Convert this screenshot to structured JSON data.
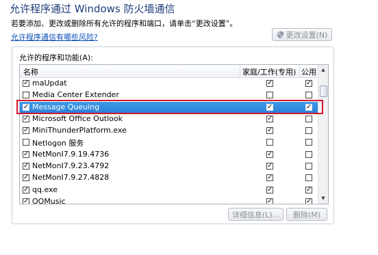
{
  "window": {
    "title": "允许程序通过 Windows 防火墙通信",
    "description": "若要添加、更改或删除所有允许的程序和端口，请单击“更改设置”。",
    "risk_link": "允许程序通信有哪些风险?",
    "change_settings_label": "更改设置(N)"
  },
  "group": {
    "label": "允许的程序和功能(A):",
    "columns": {
      "name": "名称",
      "home": "家庭/工作(专用)",
      "public": "公用"
    }
  },
  "programs": [
    {
      "name": "maUpdat",
      "enabled": true,
      "home": true,
      "public": true
    },
    {
      "name": "Media Center Extender",
      "enabled": false,
      "home": false,
      "public": false
    },
    {
      "name": "Message Queuing",
      "enabled": true,
      "home": true,
      "public": true
    },
    {
      "name": "Microsoft Office Outlook",
      "enabled": true,
      "home": true,
      "public": false
    },
    {
      "name": "MiniThunderPlatform.exe",
      "enabled": true,
      "home": true,
      "public": false
    },
    {
      "name": "Netlogon 服务",
      "enabled": false,
      "home": false,
      "public": false
    },
    {
      "name": "NetMonI7.9.19.4736",
      "enabled": true,
      "home": true,
      "public": false
    },
    {
      "name": "NetMonI7.9.23.4792",
      "enabled": true,
      "home": true,
      "public": false
    },
    {
      "name": "NetMonI7.9.27.4828",
      "enabled": true,
      "home": true,
      "public": false
    },
    {
      "name": "qq.exe",
      "enabled": true,
      "home": true,
      "public": true
    },
    {
      "name": "QQMusic",
      "enabled": true,
      "home": true,
      "public": true
    }
  ],
  "selected_program": "Message Queuing",
  "buttons": {
    "details": "详细信息(L)...",
    "delete": "删除(M)"
  },
  "colors": {
    "selection": "#3d9ae8",
    "highlight_border": "#d6162a",
    "title": "#1e3d7a"
  }
}
